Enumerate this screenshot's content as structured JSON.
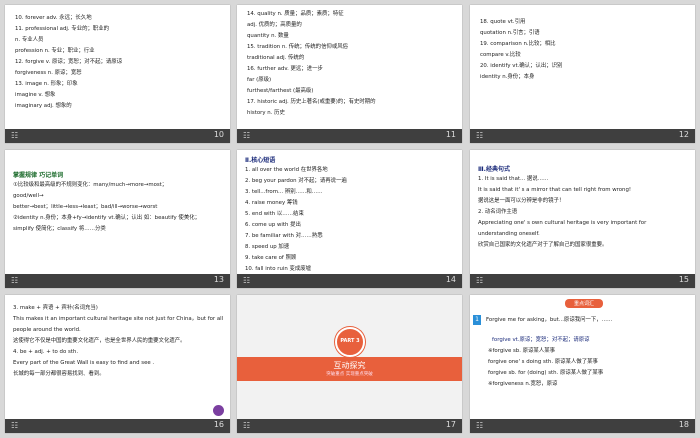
{
  "slides": [
    {
      "num": "10",
      "lines": [
        "10. forever adv.        永远；长久地",
        "11. professional adj.  专业的；职业的",
        "            n.          专业人员",
        "     profession n.      专业；职业；行业",
        "12. forgive v.          原谅；宽恕；对不起；请原谅",
        "     forgiveness n.     原谅；宽恕",
        "13. image n.            形象；印象",
        "     imagine v.         想象",
        "     imaginary adj.     想象的"
      ]
    },
    {
      "num": "11",
      "lines": [
        "14. quality n.          质量；品质；素质；特征",
        "               adj.     优质的；高质量的",
        "     quantity n.        数量",
        "15. tradition n.        传统；传统的信仰或风俗",
        "     traditional adj.   传统的",
        "16. further adv.        更远；进一步",
        "     far (原级)",
        "     furthest/farthest  (最高级)",
        "17. historic adj.       历史上著名(或重要)的；有史时期的",
        "     history n.         历史"
      ]
    },
    {
      "num": "12",
      "lines": [
        "18. quote vt.引用",
        "     quotation n.引言；引语",
        "19. comparison n.比较；相比",
        "     compare v.比较",
        "20. identify vt.确认；认出；识别",
        "     identity n.身份；本身"
      ]
    },
    {
      "num": "13",
      "title": "掌握规律  巧记单词",
      "lines": [
        "①比较级和最高级的不规则变化：many/much→more→most；",
        "good/well→",
        "better→best；little→less→least；bad/ill→worse→worst",
        "②identity n.身份；本身+fy→identify vt.确认；认出 如：beautify 使美化；",
        "simplify 使简化；classify 将……分类"
      ]
    },
    {
      "num": "14",
      "title": "Ⅱ.核心短语",
      "lines": [
        "1. all over the world     在世界各地",
        "2. beg your pardon        对不起；请再说一遍",
        "3. tell...from...         辨别……和……",
        "4. raise money            筹钱",
        "5. end with               以……结束",
        "6. come up with           提出",
        "7. be familiar with       对……熟悉",
        "8. speed up               加速",
        "9. take care of           照顾",
        "10. fall into ruin        变成废墟"
      ]
    },
    {
      "num": "15",
      "title": "Ⅲ.经典句式",
      "lines": [
        "1. It is said that... 据说……",
        "   It is said that it' s a mirror that can tell right from wrong!",
        "据说这是一面可以分辨是非的镜子！",
        "2. 动名词作主语",
        "   Appreciating one' s own cultural heritage  is  very  important  for",
        "understanding oneself.",
        "欣赏自己国家的文化遗产对于了解自己的国家很重要。"
      ]
    },
    {
      "num": "16",
      "lines": [
        "3. make + 宾语 + 宾补(名词充当)",
        "This  makes it an important cultural heritage site not just for China，but for all",
        "people around the world.",
        "这使得它不仅是中国的重要文化遗产，也是全世界人民的重要文化遗产。",
        "4. be + adj. + to do sth.",
        "Every part of the Great Wall  is easy to find and see .",
        "长城的每一部分都很容易找到、看到。"
      ]
    },
    {
      "num": "17",
      "part_label": "PART 3",
      "title": "互动探究",
      "subtitle": "突破重点 实现重点突破"
    },
    {
      "num": "18",
      "pill": "重点词汇",
      "item_num": "1",
      "lines": [
        "Forgive me for asking，but...原谅我问一下，……",
        "",
        "forgive vt.原谅；宽恕；对不起；请原谅",
        "※forgive sb. 原谅某人某事",
        "  forgive one' s doing sth. 原谅某人做了某事",
        "  forgive sb. for (doing) sth. 原谅某人做了某事",
        "※forgiveness n.宽恕，原谅"
      ]
    }
  ]
}
